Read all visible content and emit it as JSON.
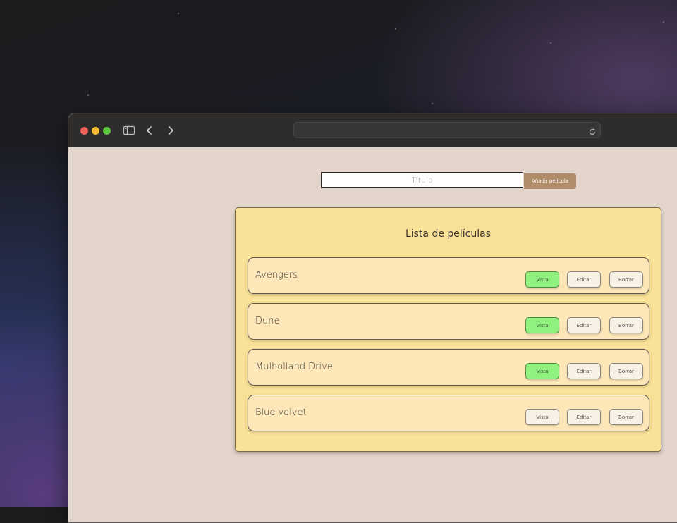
{
  "browser": {
    "address": "",
    "icons": [
      "sidebar-icon",
      "chevron-left-icon",
      "chevron-right-icon",
      "reload-icon"
    ]
  },
  "form": {
    "title_placeholder": "Título",
    "title_value": "",
    "add_label": "Añadir película"
  },
  "panel": {
    "title": "Lista de películas"
  },
  "movies": [
    {
      "title": "Avengers",
      "vista": "Vista",
      "editar": "Editar",
      "borrar": "Borrar",
      "seen": true
    },
    {
      "title": "Dune",
      "vista": "Vista",
      "editar": "Editar",
      "borrar": "Borrar",
      "seen": true
    },
    {
      "title": "Mulholland Drive",
      "vista": "Vista",
      "editar": "Editar",
      "borrar": "Borrar",
      "seen": true
    },
    {
      "title": "Blue velvet",
      "vista": "Vista",
      "editar": "Editar",
      "borrar": "Borrar",
      "seen": false
    }
  ],
  "colors": {
    "page_bg": "#e3d5cb",
    "panel_bg": "#f9e198",
    "item_bg": "#fde7b9",
    "seen_green": "#8ff27f",
    "add_button": "#b08c68"
  }
}
